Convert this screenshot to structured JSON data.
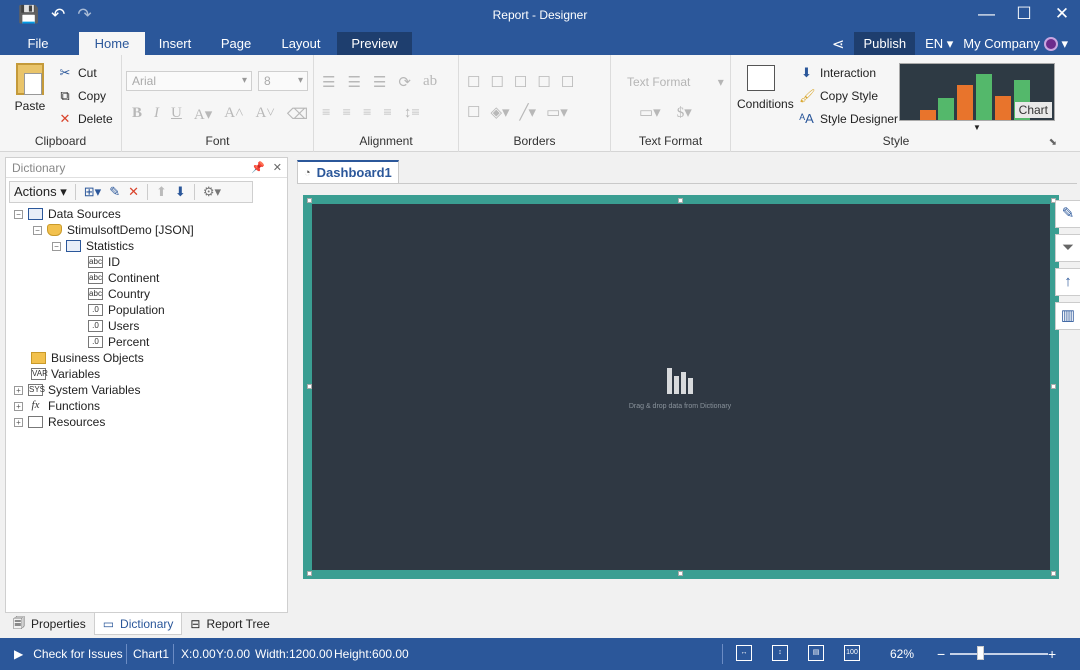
{
  "titlebar": {
    "title": "Report - Designer",
    "qat": [
      {
        "name": "save-icon",
        "glyph": "💾"
      },
      {
        "name": "undo-icon",
        "glyph": "↶"
      },
      {
        "name": "redo-icon",
        "glyph": "↷"
      }
    ],
    "window_buttons": [
      {
        "name": "minimize-icon",
        "glyph": "—"
      },
      {
        "name": "maximize-icon",
        "glyph": "☐"
      },
      {
        "name": "close-icon",
        "glyph": "✕"
      }
    ]
  },
  "menu": {
    "tabs": [
      "File",
      "Home",
      "Insert",
      "Page",
      "Layout",
      "Preview"
    ],
    "active_tab": "Home",
    "publish": "Publish",
    "language": "EN",
    "company": "My Company"
  },
  "ribbon": {
    "clipboard": {
      "label": "Clipboard",
      "paste": "Paste",
      "cut": "Cut",
      "copy": "Copy",
      "delete": "Delete"
    },
    "font": {
      "label": "Font",
      "font_name": "Arial",
      "font_size": "8"
    },
    "alignment": {
      "label": "Alignment"
    },
    "borders": {
      "label": "Borders"
    },
    "text_format": {
      "label": "Text Format",
      "combo": "Text Format"
    },
    "style": {
      "label": "Style",
      "conditions": "Conditions",
      "interaction": "Interaction",
      "copy_style": "Copy Style",
      "style_designer": "Style Designer",
      "gallery_label": "Chart"
    }
  },
  "dictionary": {
    "title": "Dictionary",
    "actions": "Actions",
    "tree": [
      {
        "label": "Data Sources",
        "icon": "table-icon"
      },
      {
        "label": "StimulsoftDemo [JSON]",
        "icon": "database-icon"
      },
      {
        "label": "Statistics",
        "icon": "table-icon"
      },
      {
        "label": "ID",
        "icon": "abc"
      },
      {
        "label": "Continent",
        "icon": "abc"
      },
      {
        "label": "Country",
        "icon": "abc"
      },
      {
        "label": "Population",
        "icon": ".0"
      },
      {
        "label": "Users",
        "icon": ".0"
      },
      {
        "label": "Percent",
        "icon": ".0"
      },
      {
        "label": "Business Objects",
        "icon": "business-objects-icon"
      },
      {
        "label": "Variables",
        "icon": "VAR"
      },
      {
        "label": "System Variables",
        "icon": "SYS"
      },
      {
        "label": "Functions",
        "icon": "fx"
      },
      {
        "label": "Resources",
        "icon": "resources-icon"
      }
    ],
    "bottom_tabs": [
      "Properties",
      "Dictionary",
      "Report Tree"
    ],
    "active_bottom_tab": "Dictionary"
  },
  "canvas": {
    "tab": "Dashboard1",
    "placeholder": "Drag & drop data from Dictionary",
    "frame_color": "#3a9e92",
    "background_color": "#2f3843"
  },
  "statusbar": {
    "check": "Check for Issues",
    "component": "Chart1",
    "x": "X:0.00",
    "y": "Y:0.00",
    "width": "Width:1200.00",
    "height": "Height:600.00",
    "zoom": "62%",
    "zoom_minus": "−",
    "zoom_plus": "+"
  },
  "colors": {
    "accent": "#2b579a",
    "accent_dark": "#1e3e6e"
  }
}
